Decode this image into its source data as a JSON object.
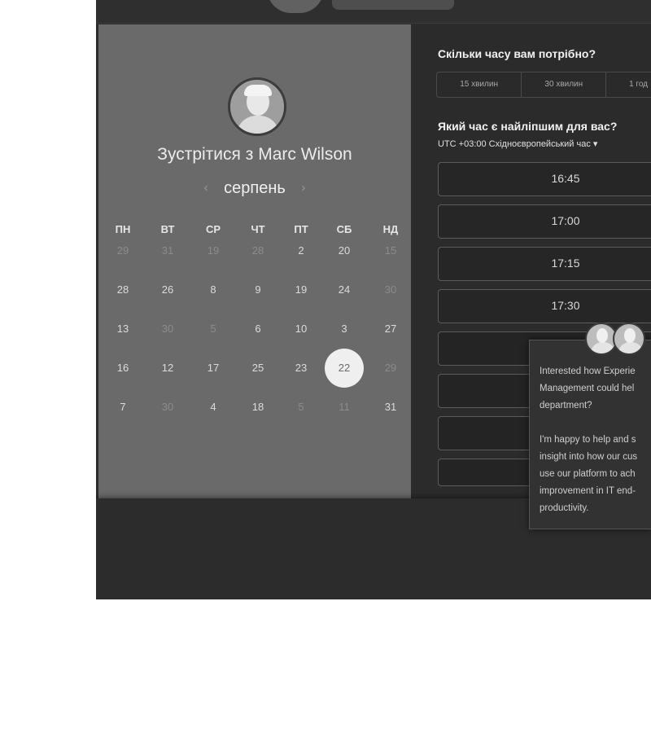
{
  "left": {
    "meet_title": "Зустрітися з Marc Wilson",
    "month": "серпень",
    "prev_icon": "chevron-left-icon",
    "next_icon": "chevron-right-icon",
    "weekdays": [
      "ПН",
      "ВТ",
      "СР",
      "ЧТ",
      "ПТ",
      "СБ",
      "НД"
    ],
    "weeks": [
      [
        "29",
        "31",
        "19",
        "28",
        "2",
        "20",
        "15"
      ],
      [
        "28",
        "26",
        "8",
        "9",
        "19",
        "24",
        "30"
      ],
      [
        "13",
        "30",
        "5",
        "6",
        "10",
        "3",
        "27"
      ],
      [
        "16",
        "12",
        "17",
        "25",
        "23",
        "22",
        "29"
      ],
      [
        "7",
        "30",
        "4",
        "18",
        "5",
        "11",
        "31"
      ]
    ],
    "selected_day": "22"
  },
  "right": {
    "duration_question": "Скільки часу вам потрібно?",
    "durations": [
      "15 хвилин",
      "30 хвилин",
      "1 год"
    ],
    "time_question": "Який час є найліпшим для вас?",
    "timezone": "UTC +03:00 Східноєвропейський час ▾",
    "slots": [
      "16:45",
      "17:00",
      "17:15",
      "17:30"
    ]
  },
  "chat": {
    "paragraph1": [
      "Interested how Experie",
      "Management could hel",
      "department?"
    ],
    "paragraph2": [
      "I'm happy to help and s",
      "insight into how our cus",
      "use our platform to ach",
      "improvement in IT end-",
      "productivity."
    ]
  }
}
